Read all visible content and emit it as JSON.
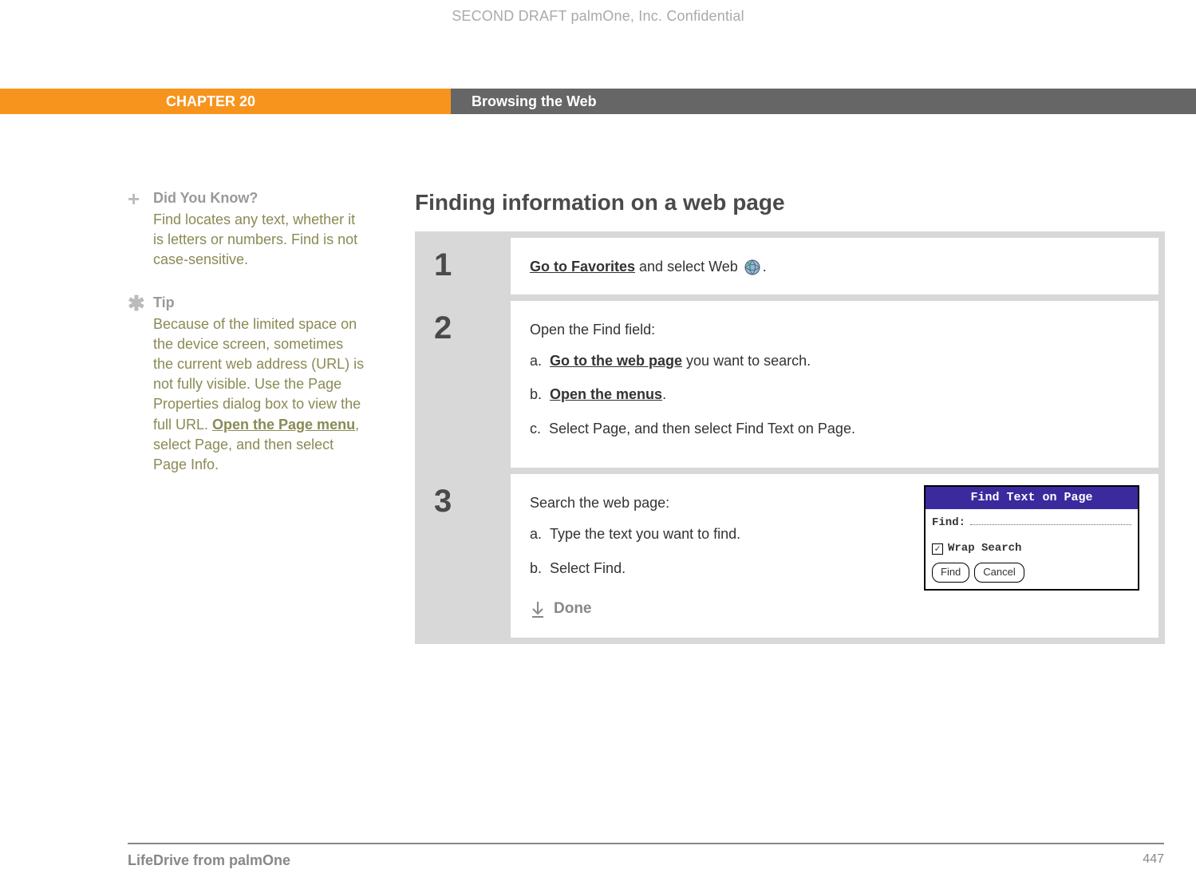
{
  "header": {
    "classification": "SECOND DRAFT palmOne, Inc.  Confidential"
  },
  "banner": {
    "chapter": "CHAPTER 20",
    "title": "Browsing the Web"
  },
  "sidebar": {
    "didyouknow": {
      "title": "Did You Know?",
      "text": "Find locates any text, whether it is letters or numbers. Find is not case-sensitive."
    },
    "tip": {
      "title": "Tip",
      "text_before": "Because of the limited space on the device screen, sometimes the current web address (URL) is not fully visible. Use the Page Properties dialog box to view the full URL. ",
      "link": "Open the Page menu",
      "text_after": ", select Page, and then select Page Info."
    }
  },
  "main": {
    "section_title": "Finding information on a web page",
    "steps": [
      {
        "num": "1",
        "intro_link": "Go to Favorites",
        "intro_rest": " and select Web ",
        "intro_end": "."
      },
      {
        "num": "2",
        "heading": "Open the Find field:",
        "items": {
          "a_marker": "a.",
          "a_link": "Go to the web page",
          "a_rest": " you want to search.",
          "b_marker": "b.",
          "b_link": "Open the menus",
          "b_rest": ".",
          "c_marker": "c.",
          "c_text": "Select Page, and then select Find Text on Page."
        }
      },
      {
        "num": "3",
        "heading": "Search the web page:",
        "items": {
          "a_marker": "a.",
          "a_text": "Type the text you want to find.",
          "b_marker": "b.",
          "b_text": "Select Find."
        },
        "done": "Done",
        "dialog": {
          "title": "Find Text on Page",
          "find_label": "Find:",
          "wrap_label": "Wrap Search",
          "btn_find": "Find",
          "btn_cancel": "Cancel"
        }
      }
    ]
  },
  "footer": {
    "product": "LifeDrive from palmOne",
    "page": "447"
  }
}
